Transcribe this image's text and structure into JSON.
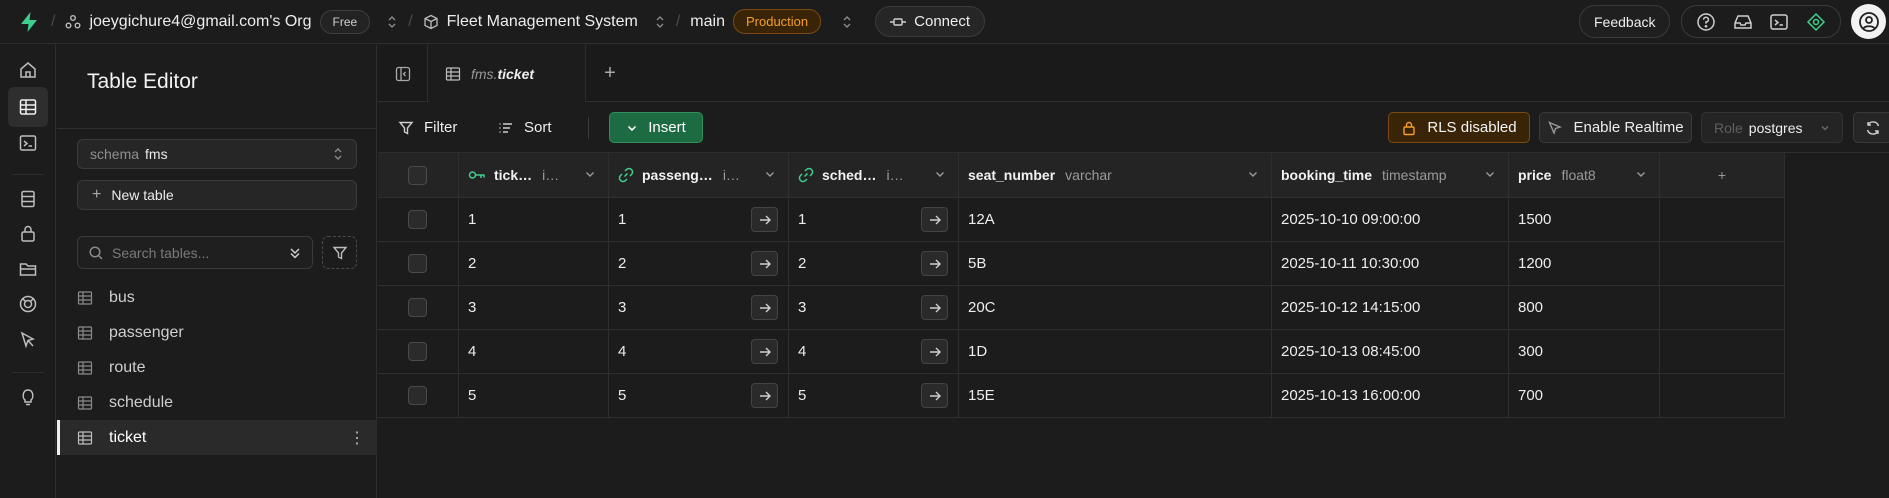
{
  "topbar": {
    "org_name": "joeygichure4@gmail.com's Org",
    "org_plan": "Free",
    "project_name": "Fleet Management System",
    "branch": "main",
    "branch_env": "Production",
    "connect_label": "Connect",
    "feedback_label": "Feedback"
  },
  "sidebar": {
    "title": "Table Editor",
    "schema_label": "schema",
    "schema_value": "fms",
    "new_table_label": "New table",
    "search_placeholder": "Search tables...",
    "tables": [
      "bus",
      "passenger",
      "route",
      "schedule",
      "ticket"
    ],
    "active_table": "ticket"
  },
  "tab": {
    "schema": "fms.",
    "table": "ticket"
  },
  "toolbar": {
    "filter_label": "Filter",
    "sort_label": "Sort",
    "insert_label": "Insert",
    "rls_label": "RLS disabled",
    "realtime_label": "Enable Realtime",
    "role_label": "Role",
    "role_value": "postgres"
  },
  "grid": {
    "columns": [
      {
        "name": "tick…",
        "type": "i…",
        "icon": "primary-key-icon"
      },
      {
        "name": "passeng…",
        "type": "i…",
        "icon": "foreign-key-link-icon"
      },
      {
        "name": "sched…",
        "type": "i…",
        "icon": "foreign-key-link-icon"
      },
      {
        "name": "seat_number",
        "type": "varchar"
      },
      {
        "name": "booking_time",
        "type": "timestamp"
      },
      {
        "name": "price",
        "type": "float8"
      }
    ],
    "rows": [
      {
        "ticket_id": "1",
        "passenger_id": "1",
        "schedule_id": "1",
        "seat_number": "12A",
        "booking_time": "2025-10-10 09:00:00",
        "price": "1500"
      },
      {
        "ticket_id": "2",
        "passenger_id": "2",
        "schedule_id": "2",
        "seat_number": "5B",
        "booking_time": "2025-10-11 10:30:00",
        "price": "1200"
      },
      {
        "ticket_id": "3",
        "passenger_id": "3",
        "schedule_id": "3",
        "seat_number": "20C",
        "booking_time": "2025-10-12 14:15:00",
        "price": "800"
      },
      {
        "ticket_id": "4",
        "passenger_id": "4",
        "schedule_id": "4",
        "seat_number": "1D",
        "booking_time": "2025-10-13 08:45:00",
        "price": "300"
      },
      {
        "ticket_id": "5",
        "passenger_id": "5",
        "schedule_id": "5",
        "seat_number": "15E",
        "booking_time": "2025-10-13 16:00:00",
        "price": "700"
      }
    ]
  },
  "colors": {
    "brand_green": "#3ecf8e",
    "insert_green": "#1d6b43",
    "production_orange": "#f59e2b"
  }
}
